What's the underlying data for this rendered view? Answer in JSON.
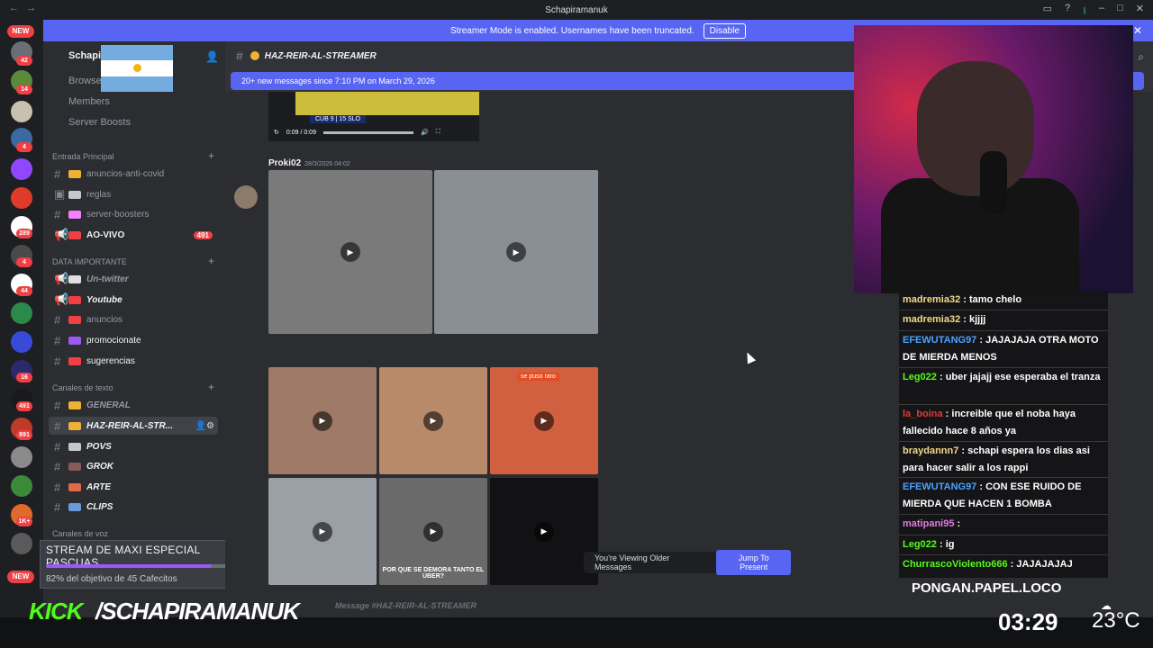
{
  "app": {
    "window_title": "Schapiramanuk"
  },
  "banner": {
    "text": "Streamer Mode is enabled. Usernames have been truncated.",
    "button": "Disable"
  },
  "server_list": {
    "new_top": "NEW",
    "new_bottom": "NEW",
    "badges": [
      "42",
      "14",
      "4",
      "289",
      "4",
      "44",
      "16",
      "491",
      "891",
      "1K+"
    ]
  },
  "sidebar": {
    "guild_name": "Schapi",
    "top_links": [
      "Browse",
      "Members",
      "Server Boosts"
    ],
    "categories": [
      {
        "name": "Entrada Principal",
        "channels": [
          {
            "name": "anuncios-anti-covid",
            "emoji_color": "#f0b232"
          },
          {
            "name": "reglas",
            "emoji_color": "#c4c9ce"
          },
          {
            "name": "server-boosters",
            "emoji_color": "#f47fff"
          },
          {
            "name": "AO-VIVO",
            "emoji_color": "#f23f43",
            "badge": "491"
          }
        ]
      },
      {
        "name": "DATA IMPORTANTE",
        "channels": [
          {
            "name": "Un-twitter",
            "emoji_color": "#e0e0e0"
          },
          {
            "name": "Youtube",
            "emoji_color": "#f23f43"
          },
          {
            "name": "anuncios",
            "emoji_color": "#f23f43"
          },
          {
            "name": "promocionate",
            "emoji_color": "#9b59f6"
          },
          {
            "name": "sugerencias",
            "emoji_color": "#f23f43"
          }
        ]
      },
      {
        "name": "Canales de texto",
        "channels": [
          {
            "name": "GENERAL",
            "emoji_color": "#f0b232"
          },
          {
            "name": "HAZ-REIR-AL-STR...",
            "emoji_color": "#f0b232"
          },
          {
            "name": "POVS",
            "emoji_color": "#c4c9ce"
          },
          {
            "name": "GROK",
            "emoji_color": "#8a5a5a"
          },
          {
            "name": "ARTE",
            "emoji_color": "#e06a4a"
          },
          {
            "name": "CLIPS",
            "emoji_color": "#6a9ad8"
          }
        ]
      },
      {
        "name": "Canales de voz"
      }
    ]
  },
  "goal": {
    "title": "STREAM DE MAXI ESPECIAL PASCUAS",
    "subtitle": "82% del objetivo de 45 Cafecitos",
    "progress": 0.82
  },
  "channel": {
    "name": "HAZ-REIR-AL-STREAMER",
    "new_messages": "20+ new messages since 7:10 PM on March 29, 2026",
    "input_placeholder": "Message #HAZ-REIR-AL-STREAMER"
  },
  "messages": {
    "video_time": "0:09 / 0:09",
    "video_score": "CUB 9 | 15 SLO",
    "author": "Proki02",
    "timestamp": "28/3/2026 04:02",
    "tiles": [
      {
        "color": "#7a7a7a"
      },
      {
        "color": "#8a8f96"
      },
      {
        "color": "#a07a68"
      },
      {
        "color": "#b88a6a"
      },
      {
        "color": "#d06040",
        "caption": "se puso raro"
      },
      {
        "color": "#9aa0a6"
      },
      {
        "color": "#6a6a6a",
        "caption": "POR QUE SE DEMORA TANTO EL UBER?"
      },
      {
        "color": "#121214"
      }
    ]
  },
  "older_bar": {
    "text": "You're Viewing Older Messages",
    "button": "Jump To Present"
  },
  "chat": {
    "lines": [
      {
        "user": "madremia32",
        "color": "#f5d88a",
        "text": ": tamo chelo"
      },
      {
        "user": "madremia32",
        "color": "#f5d88a",
        "text": ": kjjjj"
      },
      {
        "user": "EFEWUTANG97",
        "color": "#4aa3ff",
        "text": ": JAJAJAJA OTRA MOTO DE MIERDA MENOS"
      },
      {
        "user": "Leg022",
        "color": "#53fc18",
        "text": ": uber jajajj ese esperaba el tranza"
      },
      {
        "user": "la_boina",
        "color": "#e03a3a",
        "text": ": increible que el noba haya fallecido hace 8 años ya"
      },
      {
        "user": "braydannn7",
        "color": "#f5d88a",
        "text": ": schapi espera los dias asi para hacer salir a los rappi"
      },
      {
        "user": "EFEWUTANG97",
        "color": "#4aa3ff",
        "text": ": CON ESE RUIDO DE MIERDA QUE HACEN 1 BOMBA"
      },
      {
        "user": "matipani95",
        "color": "#e07ae0",
        "text": ":"
      },
      {
        "user": "Leg022",
        "color": "#53fc18",
        "text": ": ig"
      },
      {
        "user": "ChurrascoViolento666",
        "color": "#53fc18",
        "text": ": JAJAJAJAJ"
      }
    ]
  },
  "overlay": {
    "kick": "KICK",
    "handle": "/SCHAPIRAMANUK",
    "pongan": "PONGAN.PAPEL.LOCO",
    "clock": "03:29",
    "temp": "23°C"
  }
}
